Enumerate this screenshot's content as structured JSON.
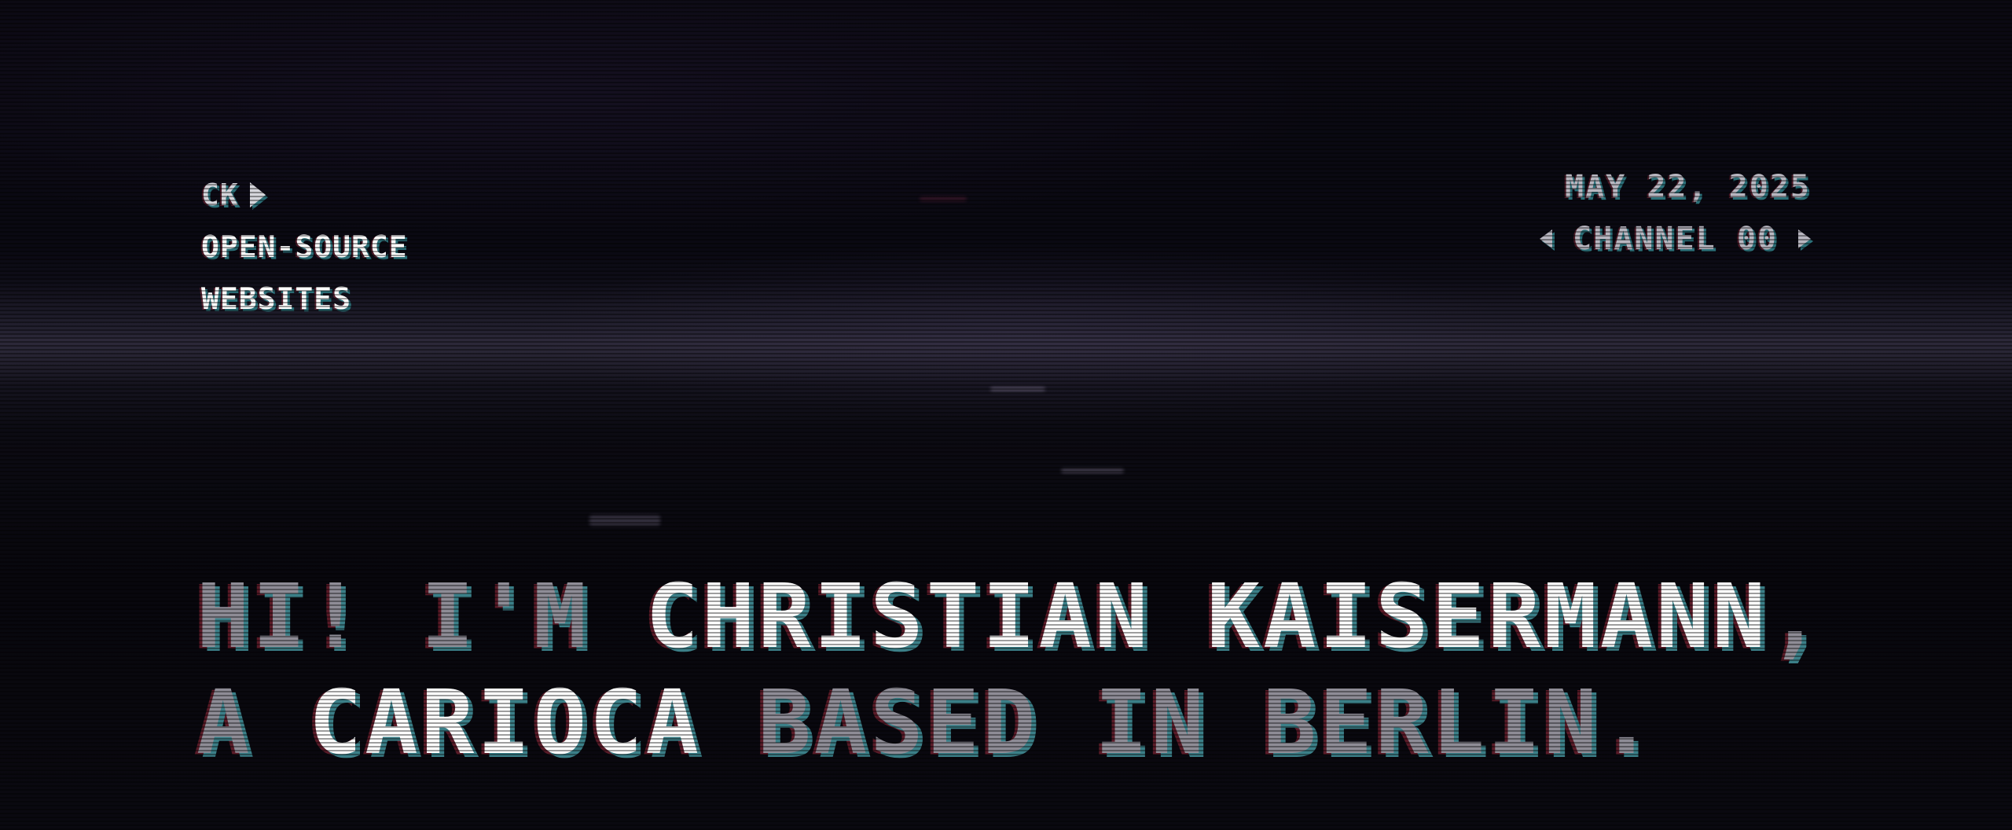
{
  "brand": {
    "logo_text": "CK",
    "tagline_line1": "OPEN-SOURCE",
    "tagline_line2": "WEBSITES"
  },
  "status": {
    "date": "MAY 22, 2025",
    "channel": "CHANNEL 00"
  },
  "headline": {
    "line1": {
      "greeting": "HI! I'M",
      "name": "CHRISTIAN KAISERMANN",
      "punct": ","
    },
    "line2": {
      "article": "A",
      "origin": "CARIOCA",
      "location": "BASED IN BERLIN",
      "punct": "."
    }
  },
  "colors": {
    "background": "#07060c",
    "text_bright": "#ffffff",
    "text_dim": "#8e8c96",
    "shadow_cyan": "#2b6f78"
  },
  "icons": {
    "logo_mark": "play-triangle-icon",
    "channel_prev": "arrow-left-icon",
    "channel_next": "arrow-right-icon"
  }
}
